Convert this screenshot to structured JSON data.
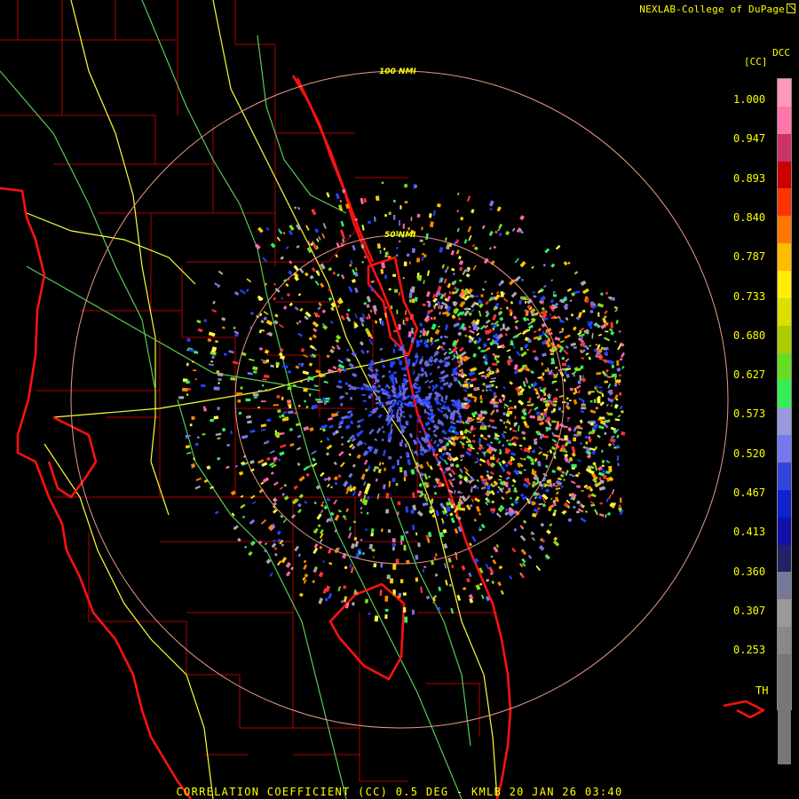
{
  "credit": "NEXLAB-College of DuPage",
  "product_label": "CORRELATION COEFFICIENT (CC) 0.5 DEG - KMLB 20 JAN 26 03:40",
  "legend": {
    "title": "DCC",
    "unit": "[CC]",
    "ticks": [
      "1.000",
      "0.947",
      "0.893",
      "0.840",
      "0.787",
      "0.733",
      "0.680",
      "0.627",
      "0.573",
      "0.520",
      "0.467",
      "0.413",
      "0.360",
      "0.307",
      "0.253"
    ],
    "threshold_label": "TH",
    "colors": [
      "#ff99bb",
      "#ff77aa",
      "#cc3366",
      "#cc0000",
      "#ff3300",
      "#ff7700",
      "#ffbb00",
      "#ffee00",
      "#dddd00",
      "#aacc00",
      "#66dd22",
      "#33ee55",
      "#9999dd",
      "#7777ee",
      "#3344dd",
      "#1122cc",
      "#1111aa",
      "#222266",
      "#777799",
      "#999999",
      "#888888",
      "#777777"
    ]
  },
  "range_rings": {
    "inner_label": "50 NMI",
    "outer_label": "100 NMI"
  },
  "colors": {
    "ring": "#e89a8a",
    "county_border": "#b00000",
    "coastline": "#ff1111",
    "highway_primary": "#ffff33",
    "highway_secondary": "#55cc55",
    "text": "#ffff00"
  },
  "echo_palette": [
    "#ff3333",
    "#ffcc00",
    "#ffff44",
    "#88dd22",
    "#33ee66",
    "#2244ff",
    "#7777ee",
    "#ff66aa",
    "#ff8800",
    "#aaaaaa"
  ]
}
